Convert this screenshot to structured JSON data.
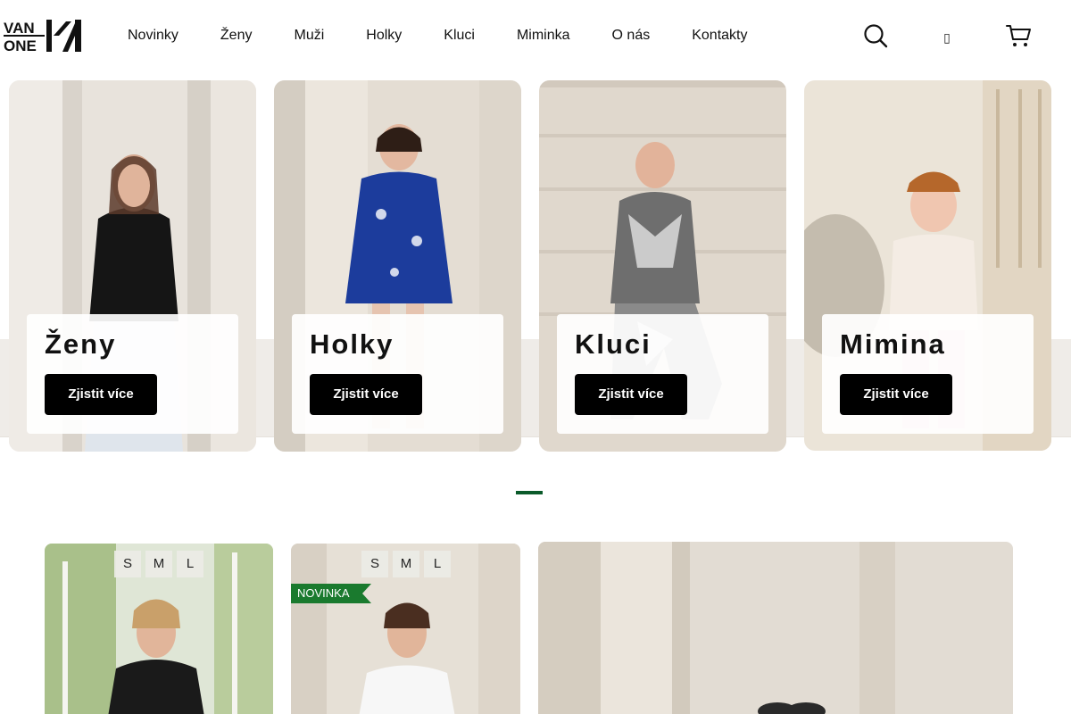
{
  "brand": {
    "logo_line1": "VAN",
    "logo_line2": "ONE"
  },
  "nav": [
    {
      "label": "Novinky"
    },
    {
      "label": "Ženy"
    },
    {
      "label": "Muži"
    },
    {
      "label": "Holky"
    },
    {
      "label": "Kluci"
    },
    {
      "label": "Miminka"
    },
    {
      "label": "O nás"
    },
    {
      "label": "Kontakty"
    }
  ],
  "header_icons": {
    "search": "search-icon",
    "user": "user-icon",
    "user_glyph": "▯",
    "cart": "cart-icon"
  },
  "categories": [
    {
      "title": "Ženy",
      "button": "Zjistit více"
    },
    {
      "title": "Holky",
      "button": "Zjistit více"
    },
    {
      "title": "Kluci",
      "button": "Zjistit více"
    },
    {
      "title": "Mimina",
      "button": "Zjistit více"
    }
  ],
  "products": [
    {
      "sizes": [
        "S",
        "M",
        "L"
      ]
    },
    {
      "sizes": [
        "S",
        "M",
        "L"
      ],
      "badge": "NOVINKA"
    }
  ],
  "colors": {
    "accent": "#0a5a2a",
    "badge": "#1a7a2e",
    "button": "#000000"
  }
}
